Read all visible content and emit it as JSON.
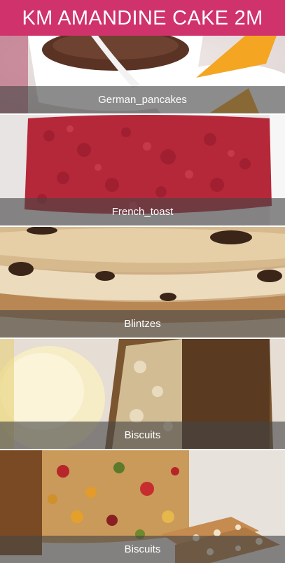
{
  "app": {
    "title": "KM AMANDINE CAKE 2M"
  },
  "items": [
    {
      "label": "German_pancakes",
      "image": "chocolate-souffle-cup-photo"
    },
    {
      "label": "French_toast",
      "image": "red-velvet-cake-photo"
    },
    {
      "label": "Blintzes",
      "image": "pancake-stack-photo"
    },
    {
      "label": "Biscuits",
      "image": "cake-with-ice-cream-photo"
    },
    {
      "label": "Biscuits",
      "image": "fruit-cake-slices-photo"
    }
  ],
  "colors": {
    "header": "#d0326c",
    "caption_overlay": "rgba(70,70,70,0.62)"
  }
}
